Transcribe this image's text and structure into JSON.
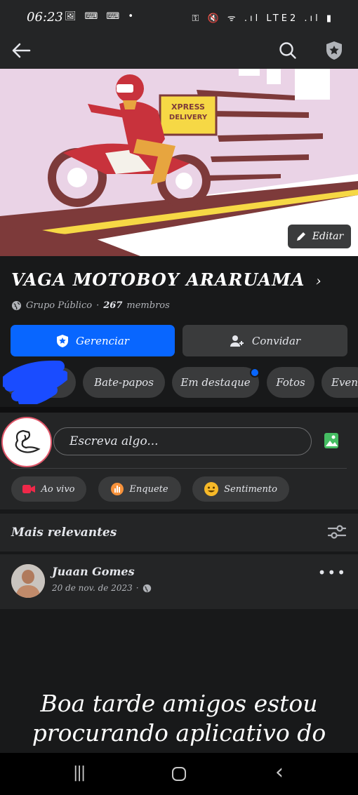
{
  "status_bar": {
    "time": "06:23",
    "left_icons": "🖼 ⌨ ⌨ •",
    "right_icons": "⚿ 🔇 ᯤ .ıl LTE2 .ıl ▮"
  },
  "cover": {
    "edit_label": "Editar"
  },
  "group": {
    "name": "VAGA MOTOBOY ARARUAMA",
    "chevron": "›",
    "privacy": "Grupo Público",
    "separator": "·",
    "members_count": "267",
    "members_label": "membros"
  },
  "buttons": {
    "manage": "Gerenciar",
    "invite": "Convidar"
  },
  "tabs": [
    "Bate-papos",
    "Em destaque",
    "Fotos",
    "Even"
  ],
  "composer": {
    "placeholder": "Escreva algo..."
  },
  "actions": {
    "live": "Ao vivo",
    "poll": "Enquete",
    "feeling": "Sentimento"
  },
  "sort": {
    "label": "Mais relevantes"
  },
  "post": {
    "author": "Juaan Gomes",
    "date": "20 de nov. de 2023",
    "dot": "·",
    "more": "•••",
    "text": "Boa tarde amigos estou procurando aplicativo do"
  },
  "navbar": {
    "recents": "|||",
    "home": "○",
    "back": "‹"
  },
  "colors": {
    "primary": "#0866ff",
    "background": "#18191a",
    "surface": "#242526",
    "chip": "#3a3b3c"
  }
}
